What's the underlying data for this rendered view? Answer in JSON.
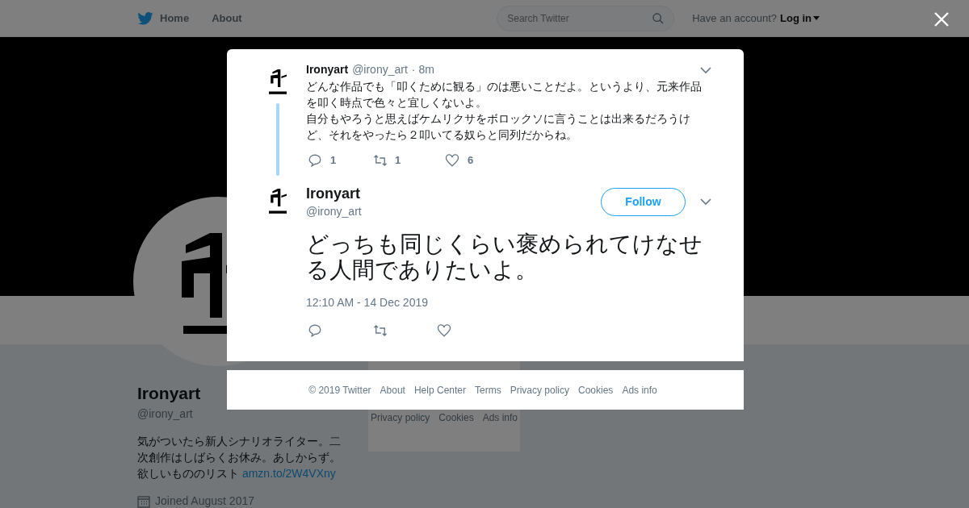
{
  "header": {
    "nav": [
      {
        "label": "Home",
        "kind": "home"
      },
      {
        "label": "About",
        "kind": "plain"
      }
    ],
    "search": {
      "placeholder": "Search Twitter"
    },
    "account_prompt": "Have an account?",
    "login": "Log in"
  },
  "profile": {
    "name": "Ironyart",
    "handle": "@irony_art",
    "bio": "気がついたら新人シナリオライター。二次創作はしばらくお休み。あしからず。欲しいもののリスト",
    "bio_link": "amzn.to/2W4VXny",
    "joined": "Joined August 2017"
  },
  "side_footer": {
    "links": [
      "Privacy policy",
      "Cookies",
      "Ads info"
    ]
  },
  "modal": {
    "parent_tweet": {
      "name": "Ironyart",
      "handle": "@irony_art",
      "separator": "·",
      "time": "8m",
      "paragraphs": [
        "どんな作品でも「叩くために観る」のは悪いことだよ。というより、元来作品を叩く時点で色々と宜しくないよ。",
        "自分もやろうと思えばケムリクサをボロックソに言うことは出来るだろうけど、それをやったら２叩いてる奴らと同列だからね。"
      ],
      "replies": "1",
      "retweets": "1",
      "likes": "6"
    },
    "tweet": {
      "name": "Ironyart",
      "handle": "@irony_art",
      "follow": "Follow",
      "text": "どっちも同じくらい褒められてけなせる人間でありたいよ。",
      "timestamp": "12:10 AM - 14 Dec 2019"
    }
  },
  "modal_footer": {
    "links": [
      "© 2019 Twitter",
      "About",
      "Help Center",
      "Terms",
      "Privacy policy",
      "Cookies",
      "Ads info"
    ]
  }
}
